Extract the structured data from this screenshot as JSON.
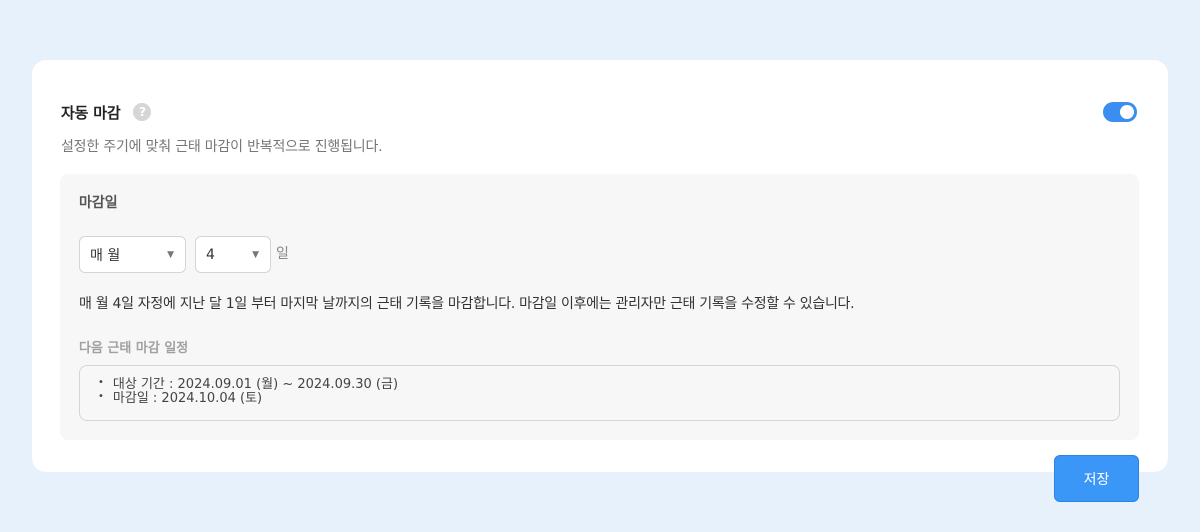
{
  "settings": {
    "title": "자동 마감",
    "help_icon": "question-circle-icon",
    "help_symbol": "?",
    "subtitle": "설정한 주기에 맞춰 근태 마감이 반복적으로 진행됩니다.",
    "toggle_enabled": true,
    "accent_color": "#3a8ef0"
  },
  "closing": {
    "label": "마감일",
    "month_select": {
      "value": "매 월",
      "icon": "caret-down-icon",
      "caret": "▼"
    },
    "day_select": {
      "value": "4",
      "icon": "caret-down-icon",
      "caret": "▼"
    },
    "day_unit": "일",
    "description": "매 월 4일 자정에 지난 달 1일 부터 마지막 날까지의 근태 기록을 마감합니다. 마감일 이후에는 관리자만 근태 기록을 수정할 수 있습니다."
  },
  "next_schedule": {
    "label": "다음 근태 마감 일정",
    "bullet": "•",
    "items": [
      "대상 기간 : 2024.09.01 (월) ~ 2024.09.30 (금)",
      "마감일 : 2024.10.04 (토)"
    ]
  },
  "actions": {
    "save_label": "저장",
    "save_color": "#3a97f7"
  }
}
